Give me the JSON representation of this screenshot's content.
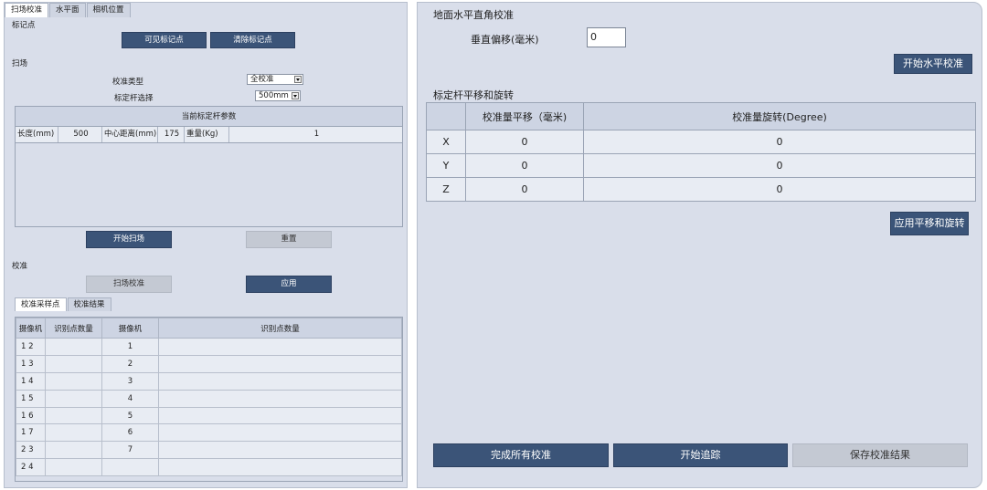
{
  "tabs": [
    "扫场校准",
    "水平面",
    "相机位置"
  ],
  "marker_section": {
    "title": "标记点",
    "show_button": "可见标记点",
    "clear_button": "清除标记点"
  },
  "scan_section": {
    "title": "扫场",
    "calib_type_label": "校准类型",
    "calib_type_value": "全校准",
    "wand_label": "标定杆选择",
    "wand_value": "500mm",
    "params_title": "当前标定杆参数",
    "length_label": "长度(mm)",
    "length_value": "500",
    "center_label": "中心距离(mm)",
    "center_value": "175",
    "weight_label": "重量(Kg)",
    "weight_value": "1",
    "start_button": "开始扫场",
    "reset_button": "重置"
  },
  "calib_section": {
    "title": "校准",
    "scan_calib_button": "扫场校准",
    "apply_button": "应用",
    "sub_tabs": [
      "校准采样点",
      "校准结果"
    ],
    "table_headers": [
      "摄像机",
      "识别点数量",
      "摄像机",
      "识别点数量"
    ],
    "rows": [
      {
        "pair": "1 2",
        "count1": "",
        "cam": "1",
        "count2": ""
      },
      {
        "pair": "1 3",
        "count1": "",
        "cam": "2",
        "count2": ""
      },
      {
        "pair": "1 4",
        "count1": "",
        "cam": "3",
        "count2": ""
      },
      {
        "pair": "1 5",
        "count1": "",
        "cam": "4",
        "count2": ""
      },
      {
        "pair": "1 6",
        "count1": "",
        "cam": "5",
        "count2": ""
      },
      {
        "pair": "1 7",
        "count1": "",
        "cam": "6",
        "count2": ""
      },
      {
        "pair": "2 3",
        "count1": "",
        "cam": "7",
        "count2": ""
      },
      {
        "pair": "2 4",
        "count1": "",
        "cam": "",
        "count2": ""
      }
    ]
  },
  "right": {
    "title": "地面水平直角校准",
    "offset_label": "垂直偏移(毫米)",
    "offset_value": "0",
    "level_button": "开始水平校准",
    "wand_title": "标定杆平移和旋转",
    "table_headers": [
      "",
      "校准量平移（毫米)",
      "校准量旋转(Degree)"
    ],
    "rows": [
      {
        "axis": "X",
        "translation": "0",
        "rotation": "0"
      },
      {
        "axis": "Y",
        "translation": "0",
        "rotation": "0"
      },
      {
        "axis": "Z",
        "translation": "0",
        "rotation": "0"
      }
    ],
    "apply_button": "应用平移和旋转",
    "finish_button": "完成所有校准",
    "track_button": "开始追踪",
    "save_button": "保存校准结果"
  }
}
